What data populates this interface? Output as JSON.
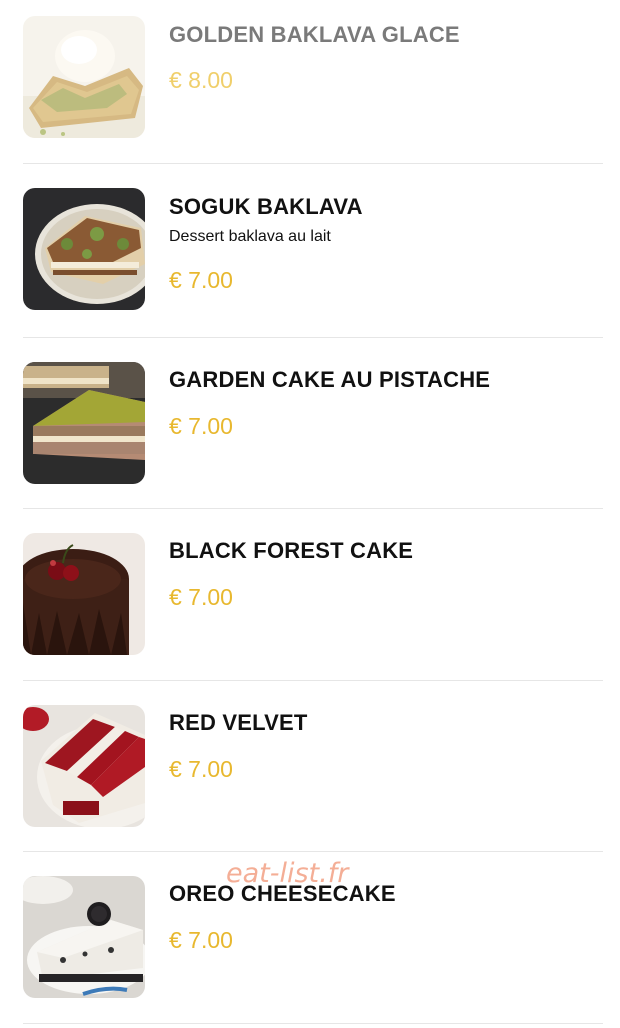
{
  "menu": {
    "items": [
      {
        "name": "GOLDEN BAKLAVA GLACE",
        "description": "",
        "price": "€ 8.00"
      },
      {
        "name": "SOGUK BAKLAVA",
        "description": "Dessert baklava au lait",
        "price": "€ 7.00"
      },
      {
        "name": "GARDEN CAKE AU PISTACHE",
        "description": "",
        "price": "€ 7.00"
      },
      {
        "name": "BLACK FOREST CAKE",
        "description": "",
        "price": "€ 7.00"
      },
      {
        "name": "RED VELVET",
        "description": "",
        "price": "€ 7.00"
      },
      {
        "name": "OREO CHEESECAKE",
        "description": "",
        "price": "€ 7.00"
      }
    ]
  },
  "watermark": "eat-list.fr",
  "colors": {
    "price": "#e8b82f",
    "name": "#111111",
    "divider": "#e6e6e6"
  }
}
